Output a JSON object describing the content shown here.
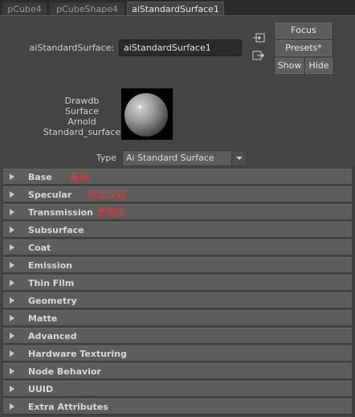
{
  "tabs": [
    "pCube4",
    "pCubeShape4",
    "aiStandardSurface1"
  ],
  "shader": {
    "name_label": "aiStandardSurface:",
    "name_value": "aiStandardSurface1"
  },
  "buttons": {
    "focus": "Focus",
    "presets": "Presets*",
    "show": "Show",
    "hide": "Hide"
  },
  "swatch_label": [
    "Drawdb",
    "Surface",
    "Arnold",
    "Standard_surface"
  ],
  "type": {
    "label": "Type",
    "value": "Ai Standard Surface"
  },
  "sections": [
    {
      "label": "Base",
      "note": "基础"
    },
    {
      "label": "Specular",
      "note": "镜面反射"
    },
    {
      "label": "Transmission",
      "note": "透明度"
    },
    {
      "label": "Subsurface",
      "note": ""
    },
    {
      "label": "Coat",
      "note": ""
    },
    {
      "label": "Emission",
      "note": ""
    },
    {
      "label": "Thin Film",
      "note": ""
    },
    {
      "label": "Geometry",
      "note": ""
    },
    {
      "label": "Matte",
      "note": ""
    },
    {
      "label": "Advanced",
      "note": ""
    },
    {
      "label": "Hardware Texturing",
      "note": ""
    },
    {
      "label": "Node Behavior",
      "note": ""
    },
    {
      "label": "UUID",
      "note": ""
    },
    {
      "label": "Extra Attributes",
      "note": ""
    }
  ],
  "colors": {
    "panel": "#444444",
    "section_bar": "#5d5d5d",
    "annotation": "#d94040"
  },
  "icons": [
    "input-connection-icon",
    "output-connection-icon",
    "expand-arrow-icon",
    "dropdown-arrow-icon"
  ]
}
